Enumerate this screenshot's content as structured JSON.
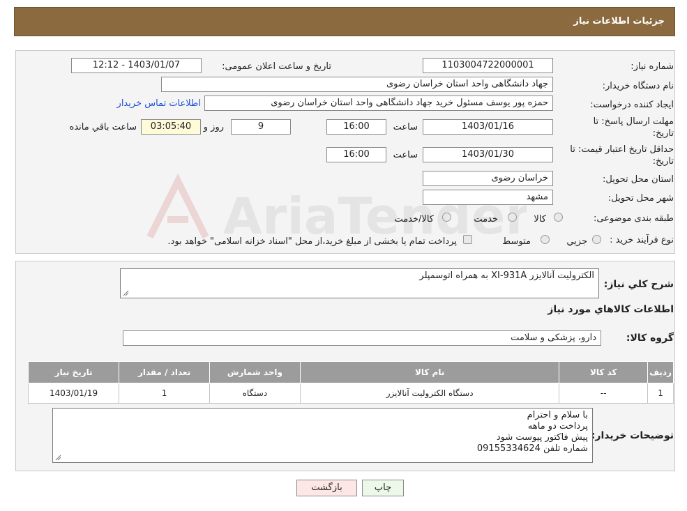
{
  "header": {
    "title": "جزئیات اطلاعات نیاز"
  },
  "form": {
    "need_number_label": "شماره نیاز:",
    "need_number": "1103004722000001",
    "announce_label": "تاریخ و ساعت اعلان عمومی:",
    "announce_value": "1403/01/07 - 12:12",
    "buyer_org_label": "نام دستگاه خریدار:",
    "buyer_org": "جهاد دانشگاهی واحد استان خراسان رضوی",
    "requester_label": "ایجاد کننده درخواست:",
    "requester": "حمزه  پور یوسف مسئول خرید جهاد دانشگاهی واحد استان خراسان رضوی",
    "contact_link": "اطلاعات تماس خریدار",
    "deadline_label_1": "مهلت ارسال پاسخ: تا",
    "deadline_label_2": "تاریخ:",
    "deadline_date": "1403/01/16",
    "time_label": "ساعت",
    "deadline_time": "16:00",
    "days": "9",
    "days_label": "روز و",
    "remaining_time": "03:05:40",
    "remaining_label": "ساعت باقي مانده",
    "validity_label_1": "حداقل تاریخ اعتبار قیمت: تا",
    "validity_label_2": "تاریخ:",
    "validity_date": "1403/01/30",
    "validity_time": "16:00",
    "province_label": "استان محل تحویل:",
    "province": "خراسان رضوی",
    "city_label": "شهر محل تحویل:",
    "city": "مشهد",
    "category_label": "طبقه بندی موضوعی:",
    "category_options": [
      "کالا",
      "خدمت",
      "کالا/خدمت"
    ],
    "process_label": "نوع فرآیند خرید :",
    "process_options": [
      "جزيي",
      "متوسط"
    ],
    "process_note": "پرداخت تمام یا بخشی از مبلغ خرید،از محل \"اسناد خزانه اسلامی\" خواهد بود."
  },
  "watermark": {
    "text": "AriaTender.neT"
  },
  "description": {
    "label": "شرح کلي نیاز:",
    "value": "الکترولیت آنالایزر XI-931A به همراه اتوسمپلر"
  },
  "goods": {
    "section_title": "اطلاعات کالاهاي مورد نیاز",
    "group_label": "گروه کالا:",
    "group_value": "دارو، پزشکی و سلامت"
  },
  "table": {
    "headers": [
      "ردیف",
      "کد کالا",
      "نام کالا",
      "واحد شمارش",
      "تعداد / مقدار",
      "تاریخ نیاز"
    ],
    "rows": [
      [
        "1",
        "--",
        "دستگاه الکترولیت آنالایزر",
        "دستگاه",
        "1",
        "1403/01/19"
      ]
    ]
  },
  "buyer_notes": {
    "label": "توضیحات خریدار:",
    "lines": [
      "با سلام و احترام",
      "پرداخت دو ماهه",
      "پیش فاکتور پیوست شود",
      "شماره تلفن 09155334624"
    ]
  },
  "buttons": {
    "print": "چاپ",
    "back": "بازگشت"
  }
}
